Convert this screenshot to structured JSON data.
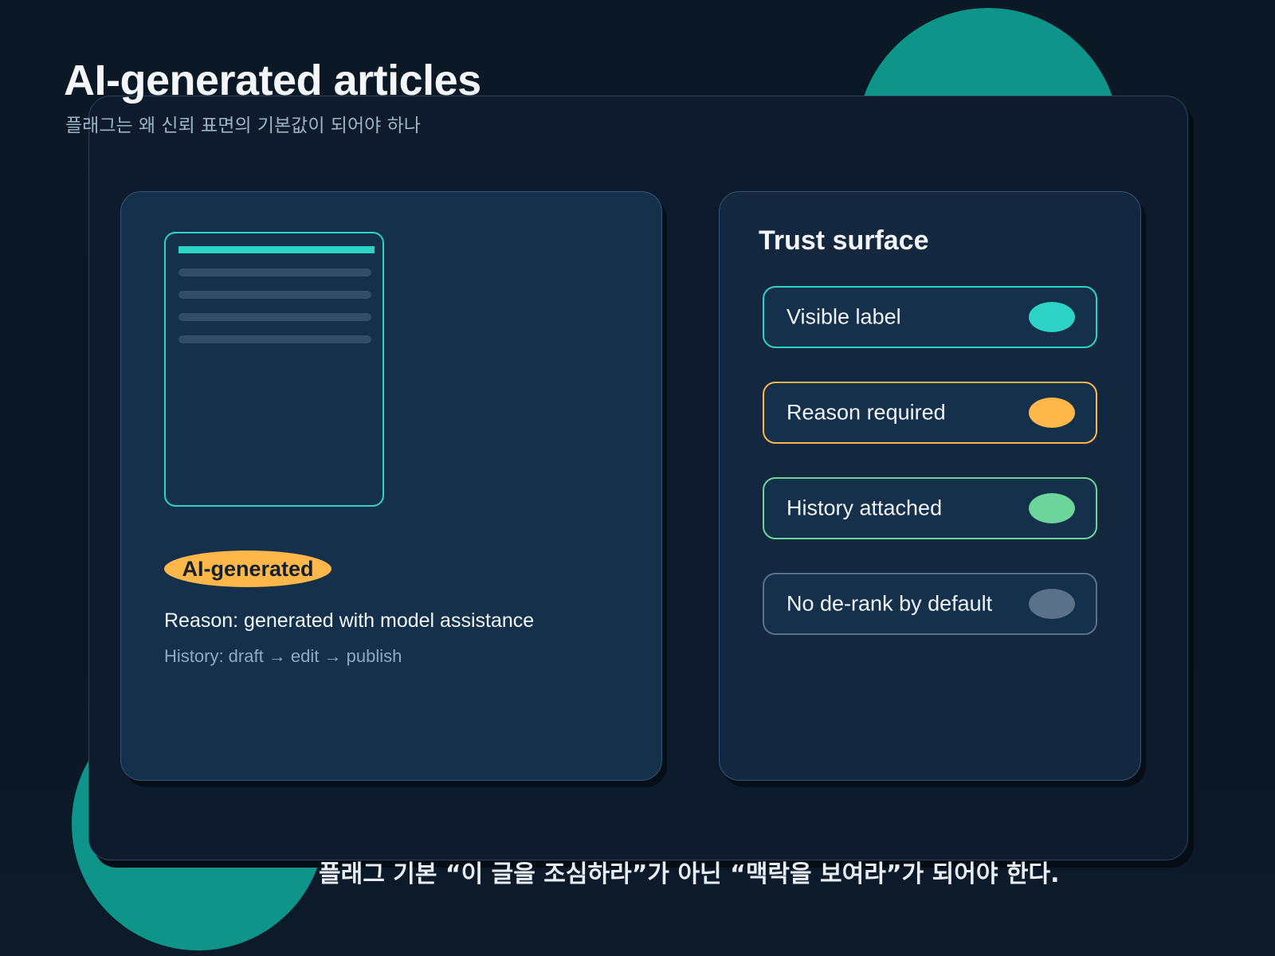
{
  "header": {
    "title": "AI-generated articles",
    "subtitle": "플래그는 왜 신뢰 표면의 기본값이 되어야 하나"
  },
  "article_card": {
    "badge": "AI-generated",
    "reason": "Reason: generated with model assistance",
    "history": "History: draft → edit → publish"
  },
  "trust_surface": {
    "title": "Trust surface",
    "items": [
      {
        "label": "Visible label",
        "color": "#2dd4c6"
      },
      {
        "label": "Reason required",
        "color": "#ffb74a"
      },
      {
        "label": "History attached",
        "color": "#6dd59b"
      },
      {
        "label": "No de-rank by default",
        "color": "#5b7089"
      }
    ]
  },
  "footer": {
    "note": "플래그 기본 “이 글을 조심하라”가 아닌 “맥락을 보여라”가 되어야 한다."
  },
  "colors": {
    "accent_teal": "#2dd4c6",
    "accent_orange": "#ffb74a",
    "accent_green": "#6dd59b",
    "muted_slate": "#5b7089",
    "decor_teal": "#0e9488"
  }
}
